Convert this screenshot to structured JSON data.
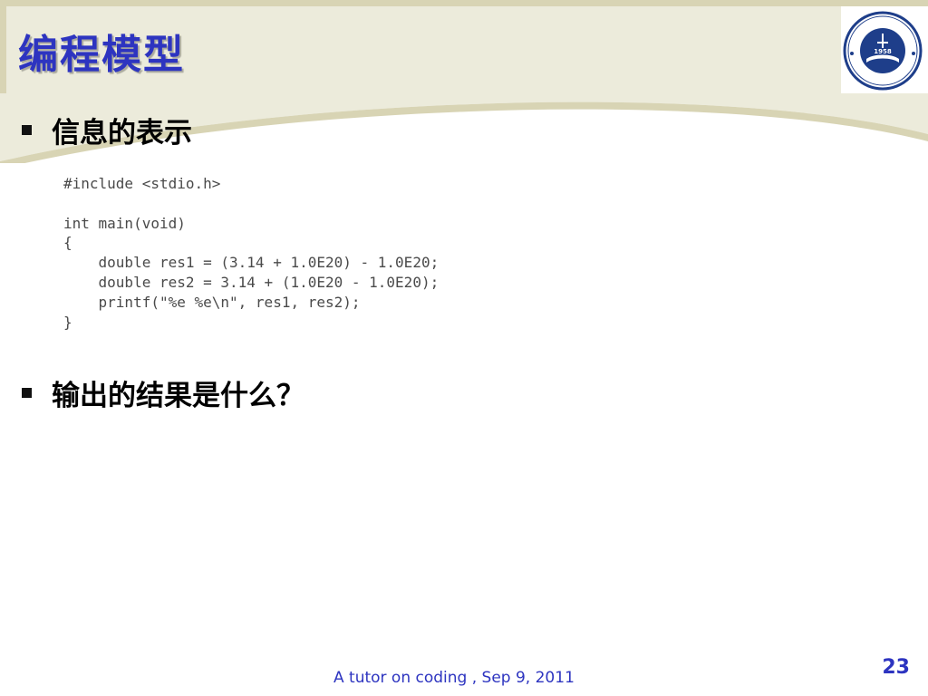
{
  "slide": {
    "title": "编程模型",
    "bullets": [
      {
        "text": "信息的表示"
      },
      {
        "text": "输出的结果是什么？"
      }
    ],
    "code_lines": [
      "#include <stdio.h>",
      "",
      "int main(void)",
      "{",
      "    double res1 = (3.14 + 1.0E20) - 1.0E20;",
      "    double res2 = 3.14 + (1.0E20 - 1.0E20);",
      "    printf(\"%e %e\\n\", res1, res2);",
      "}"
    ],
    "footer": "A tutor on coding , Sep 9, 2011",
    "page_number": "23"
  },
  "logo": {
    "year": "1958"
  },
  "colors": {
    "title": "#2d34c0",
    "header_band": "#ecebdb",
    "header_frame": "#d8d4b4",
    "logo_blue": "#1e3e8a"
  }
}
